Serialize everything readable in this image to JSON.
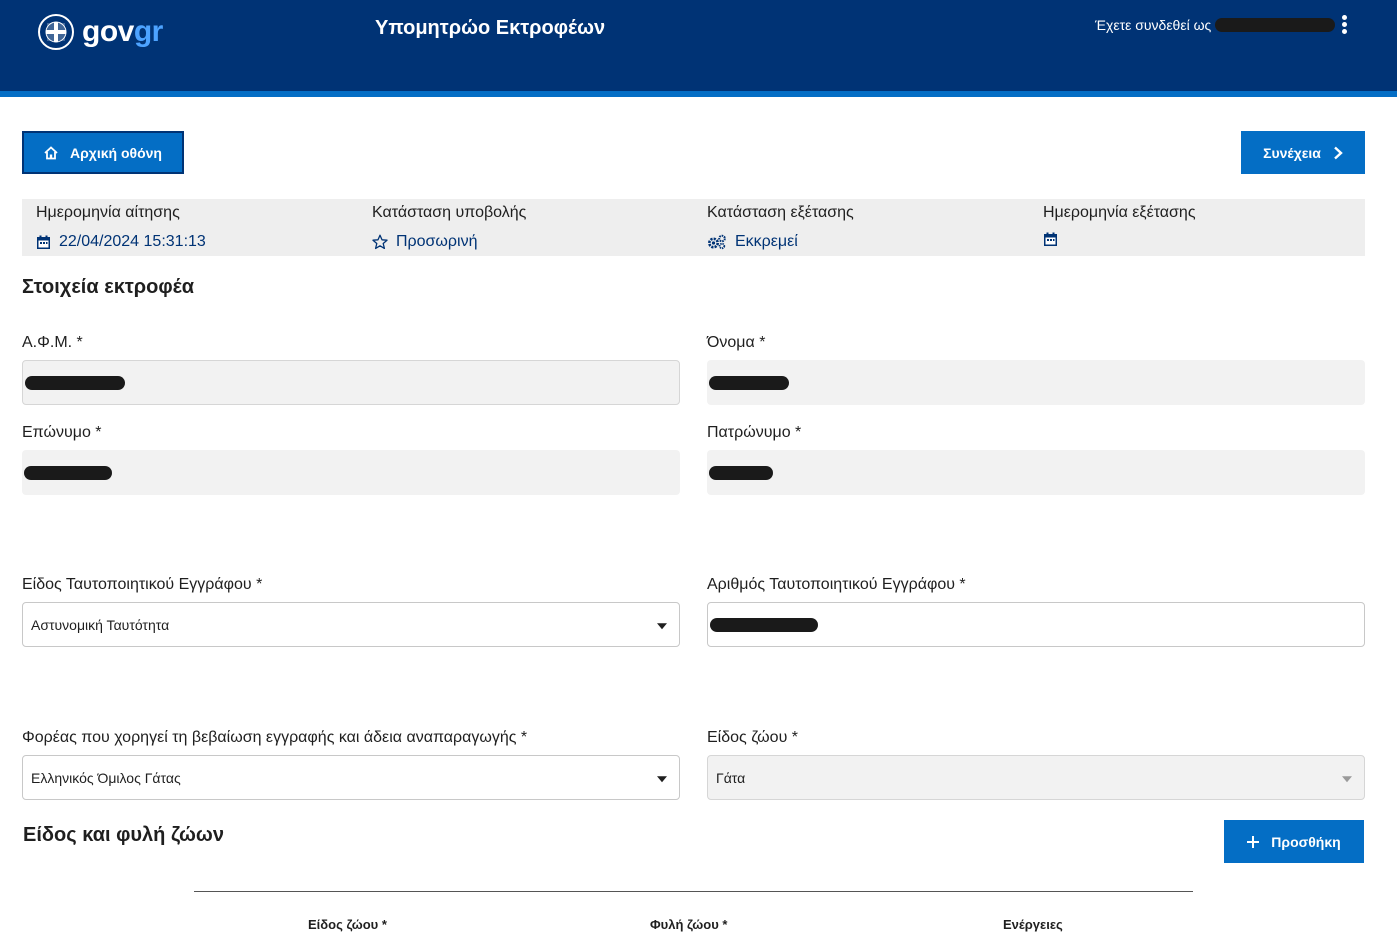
{
  "header": {
    "logo_gov": "gov",
    "logo_gr": "gr",
    "title": "Υπομητρώο Εκτροφέων",
    "logged_in_label": "Έχετε συνδεθεί ως"
  },
  "toolbar": {
    "home_label": "Αρχική οθόνη",
    "next_label": "Συνέχεια"
  },
  "status": {
    "request_date_label": "Ημερομηνία αίτησης",
    "request_date_value": "22/04/2024 15:31:13",
    "submission_status_label": "Κατάσταση υποβολής",
    "submission_status_value": "Προσωρινή",
    "review_status_label": "Κατάσταση εξέτασης",
    "review_status_value": "Εκκρεμεί",
    "review_date_label": "Ημερομηνία εξέτασης",
    "review_date_value": ""
  },
  "breeder_section": {
    "title": "Στοιχεία εκτροφέα",
    "afm_label": "Α.Φ.Μ. *",
    "first_name_label": "Όνομα *",
    "last_name_label": "Επώνυμο *",
    "father_name_label": "Πατρώνυμο *",
    "id_doc_type_label": "Είδος Ταυτοποιητικού Εγγράφου *",
    "id_doc_type_value": "Αστυνομική Ταυτότητα",
    "id_doc_number_label": "Αριθμός Ταυτοποιητικού Εγγράφου *",
    "issuer_label": "Φορέας που χορηγεί τη βεβαίωση εγγραφής και άδεια αναπαραγωγής *",
    "issuer_value": "Ελληνικός Όμιλος Γάτας",
    "animal_type_label": "Είδος ζώου *",
    "animal_type_value": "Γάτα"
  },
  "breeds_section": {
    "title": "Είδος και φυλή ζώων",
    "add_label": "Προσθήκη",
    "columns": [
      "Είδος ζώου *",
      "Φυλή ζώου *",
      "Ενέργειες"
    ]
  },
  "colors": {
    "header_bg": "#003375",
    "accent": "#046ec5",
    "status_text": "#003375"
  }
}
